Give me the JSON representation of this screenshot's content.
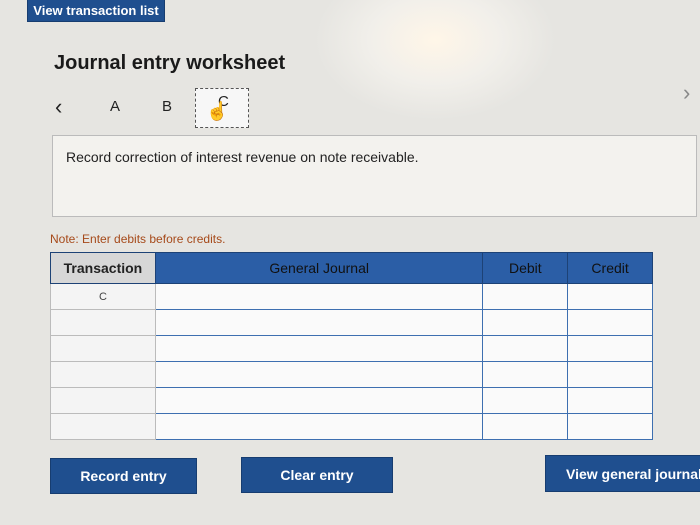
{
  "header": {
    "view_list_label": "View transaction list"
  },
  "worksheet": {
    "title": "Journal entry worksheet",
    "tabs": [
      {
        "label": "A"
      },
      {
        "label": "B"
      },
      {
        "label": "C"
      }
    ],
    "instruction": "Record correction of interest revenue on note receivable.",
    "note": "Note: Enter debits before credits."
  },
  "table": {
    "headers": [
      "Transaction",
      "General Journal",
      "Debit",
      "Credit"
    ],
    "rows": [
      {
        "transaction": "C",
        "account": "",
        "debit": "",
        "credit": ""
      },
      {
        "transaction": "",
        "account": "",
        "debit": "",
        "credit": ""
      },
      {
        "transaction": "",
        "account": "",
        "debit": "",
        "credit": ""
      },
      {
        "transaction": "",
        "account": "",
        "debit": "",
        "credit": ""
      },
      {
        "transaction": "",
        "account": "",
        "debit": "",
        "credit": ""
      },
      {
        "transaction": "",
        "account": "",
        "debit": "",
        "credit": ""
      }
    ]
  },
  "buttons": {
    "record": "Record entry",
    "clear": "Clear entry",
    "view_gj": "View general journal"
  },
  "colors": {
    "accent": "#1f4f8f",
    "header_blue": "#2b5ea6",
    "note": "#a64a1a"
  }
}
